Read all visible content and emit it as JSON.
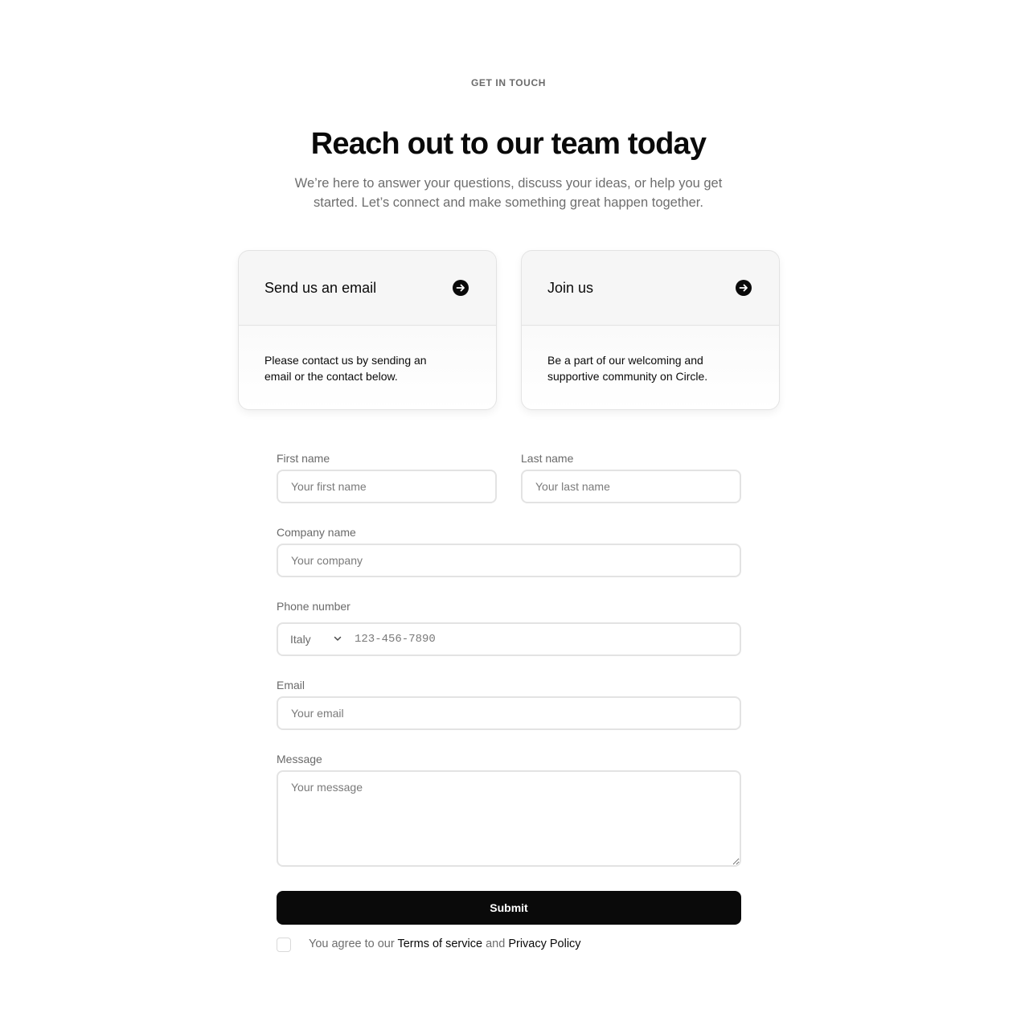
{
  "header": {
    "eyebrow": "GET IN TOUCH",
    "title": "Reach out to our team today",
    "subtitle": "We’re here to answer your questions, discuss your ideas, or help you get started. Let’s connect and make something great happen together."
  },
  "cards": [
    {
      "title": "Send us an email",
      "body": "Please contact us by sending an email or the contact below.",
      "icon": "arrow-right-circle-icon"
    },
    {
      "title": "Join us",
      "body": "Be a part of our welcoming and supportive community on Circle.",
      "icon": "arrow-right-circle-icon"
    }
  ],
  "form": {
    "first_name": {
      "label": "First name",
      "placeholder": "Your first name",
      "value": ""
    },
    "last_name": {
      "label": "Last name",
      "placeholder": "Your last name",
      "value": ""
    },
    "company": {
      "label": "Company name",
      "placeholder": "Your company",
      "value": ""
    },
    "phone": {
      "label": "Phone number",
      "country": "Italy",
      "placeholder": "123-456-7890",
      "value": ""
    },
    "email": {
      "label": "Email",
      "placeholder": "Your email",
      "value": ""
    },
    "message": {
      "label": "Message",
      "placeholder": "Your message",
      "value": ""
    },
    "submit_label": "Submit",
    "agreement": {
      "prefix": "You agree to our",
      "terms_link": "Terms of service",
      "conjunction": "and",
      "privacy_link": "Privacy Policy",
      "checked": false
    }
  },
  "colors": {
    "primary": "#0a0a0a",
    "muted_text": "#6e6e6e",
    "border": "#e3e3e3",
    "card_bg": "#f6f6f6"
  }
}
